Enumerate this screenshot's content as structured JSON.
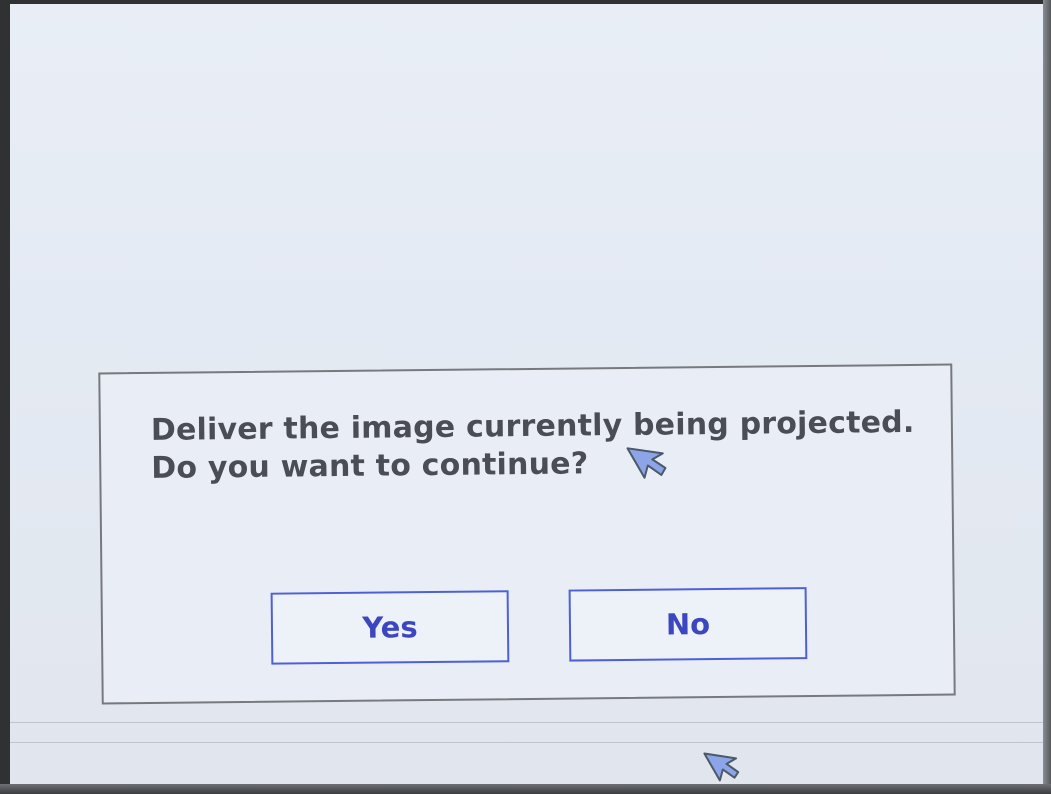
{
  "dialog": {
    "message_line1": "Deliver the image currently being projected.",
    "message_line2": "Do you want to continue?",
    "yes_label": "Yes",
    "no_label": "No"
  },
  "icons": {
    "dialog_cursor": "mouse-cursor-icon",
    "bottom_cursor": "mouse-cursor-icon"
  },
  "colors": {
    "screen_background": "#e5ebf4",
    "dialog_border": "#77797e",
    "message_text": "#4a4d55",
    "button_border": "#4f5fd8",
    "button_text": "#3c46bf",
    "cursor": "#8da4e8"
  }
}
